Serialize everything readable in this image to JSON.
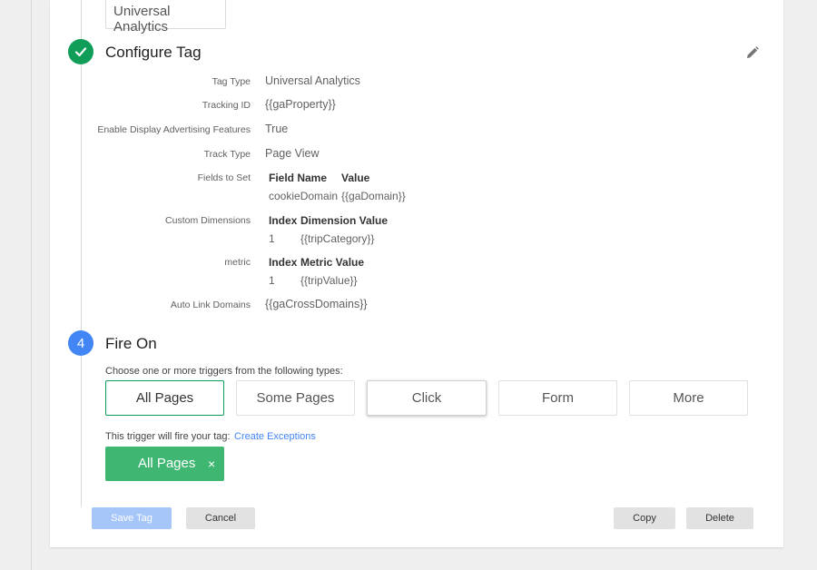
{
  "tag_type_chip": "Universal Analytics",
  "configure": {
    "title": "Configure Tag",
    "props": [
      {
        "label": "Tag Type",
        "value": "Universal Analytics"
      },
      {
        "label": "Tracking ID",
        "value": "{{gaProperty}}"
      },
      {
        "label": "Enable Display Advertising Features",
        "value": "True"
      },
      {
        "label": "Track Type",
        "value": "Page View"
      }
    ],
    "fields_to_set": {
      "label": "Fields to Set",
      "headers": [
        "Field Name",
        "Value"
      ],
      "row": [
        "cookieDomain",
        "{{gaDomain}}"
      ]
    },
    "custom_dimensions": {
      "label": "Custom Dimensions",
      "headers": [
        "Index",
        "Dimension Value"
      ],
      "row": [
        "1",
        "{{tripCategory}}"
      ]
    },
    "metric": {
      "label": "metric",
      "headers": [
        "Index",
        "Metric Value"
      ],
      "row": [
        "1",
        "{{tripValue}}"
      ]
    },
    "auto_link": {
      "label": "Auto Link Domains",
      "value": "{{gaCrossDomains}}"
    }
  },
  "fire_on": {
    "step_number": "4",
    "title": "Fire On",
    "choose_text": "Choose one or more triggers from the following types:",
    "types": [
      "All Pages",
      "Some Pages",
      "Click",
      "Form",
      "More"
    ],
    "fire_text": "This trigger will fire your tag:",
    "exceptions_link": "Create Exceptions",
    "active_trigger": "All Pages",
    "remove_glyph": "×"
  },
  "buttons": {
    "save": "Save Tag",
    "cancel": "Cancel",
    "copy": "Copy",
    "delete": "Delete"
  },
  "colors": {
    "done_green": "#0f9d58",
    "step_blue": "#4285f4",
    "active_trigger_green": "#3fb772",
    "save_disabled_blue": "#a6c6fa"
  },
  "icons": [
    "check-icon",
    "pencil-icon",
    "close-icon"
  ]
}
